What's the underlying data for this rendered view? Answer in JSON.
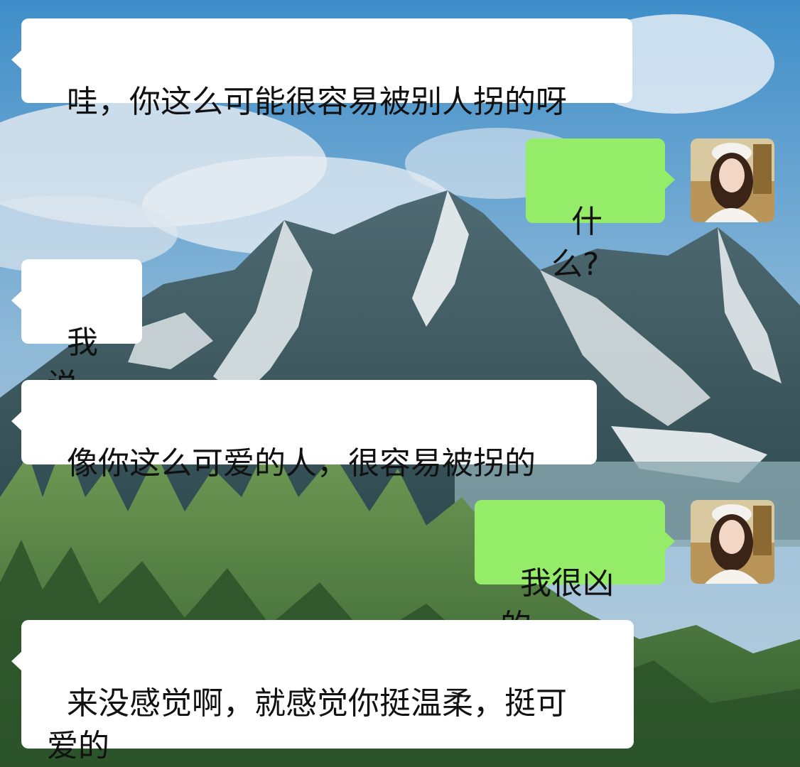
{
  "chat": {
    "messages": [
      {
        "side": "left",
        "text": "哇，你这么可能很容易被别人拐的呀"
      },
      {
        "side": "right",
        "text": "什么?"
      },
      {
        "side": "left",
        "text": "我说"
      },
      {
        "side": "left",
        "text": "像你这么可爱的人，很容易被拐的"
      },
      {
        "side": "right",
        "text": "我很凶的"
      },
      {
        "side": "left",
        "text": "来没感觉啊，就感觉你挺温柔，挺可\n爱的"
      }
    ]
  },
  "colors": {
    "incoming_bubble": "#ffffff",
    "outgoing_bubble": "#95ec69"
  }
}
